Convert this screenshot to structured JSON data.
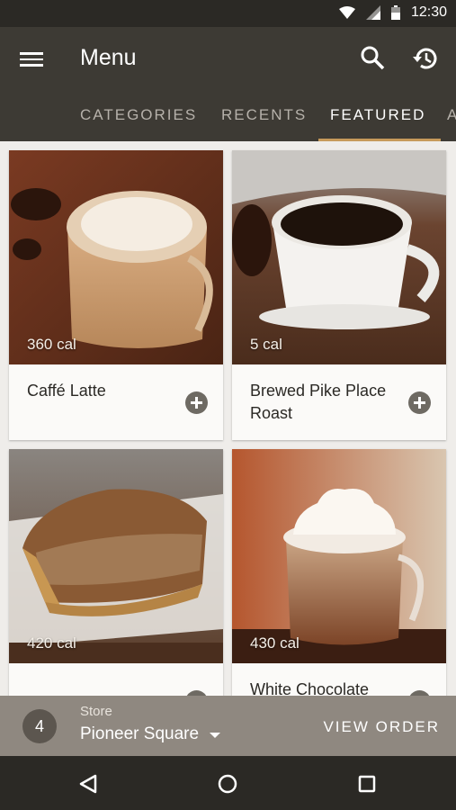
{
  "status_bar": {
    "time": "12:30",
    "icons": [
      "wifi-icon",
      "signal-icon",
      "battery-icon"
    ]
  },
  "app_bar": {
    "title": "Menu",
    "icons": [
      "menu-icon",
      "search-icon",
      "history-icon"
    ]
  },
  "tabs": [
    {
      "label": "CATEGORIES",
      "active": false
    },
    {
      "label": "RECENTS",
      "active": false
    },
    {
      "label": "FEATURED",
      "active": true
    }
  ],
  "products": [
    {
      "name": "Caffé Latte",
      "calories": "360 cal"
    },
    {
      "name": "Brewed Pike Place Roast",
      "calories": "5 cal"
    },
    {
      "name": "",
      "calories": "420 cal"
    },
    {
      "name": "White Chocolate",
      "calories": "430 cal"
    }
  ],
  "order_bar": {
    "count": "4",
    "store_label": "Store",
    "store_name": "Pioneer Square",
    "action": "VIEW ORDER"
  },
  "colors": {
    "app_bar": "#3d3a34",
    "status_bar": "#2b2925",
    "accent": "#c79a5a",
    "order_bar": "#8f8880"
  }
}
